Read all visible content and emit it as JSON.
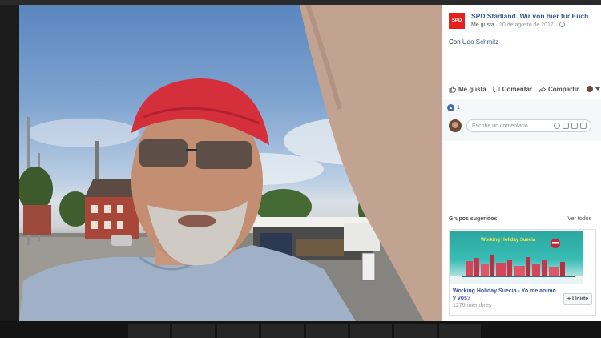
{
  "post": {
    "page_name": "SPD Stadland. Wir von hier für Euch",
    "page_logo": "SPD",
    "like_link": "Me gusta",
    "date": " · 10 de agosto de 2017 ·",
    "caption_prefix": "Con ",
    "tagged_person": "Udo Schmitz",
    "like_count": "1"
  },
  "actions": {
    "like_label": "Me gusta",
    "comment_label": "Comentar",
    "share_label": "Compartir"
  },
  "comment": {
    "placeholder": "Escribe un comentario..."
  },
  "groups": {
    "title": "Grupos sugeridos",
    "see_all": "Ver todos",
    "card": {
      "banner_title": "Working Holiday Suecia",
      "name": "Working Holiday Suecia - Yo me animo y vos?",
      "members": "1276 miembres",
      "join_label": "+ Unirte"
    }
  },
  "colors": {
    "link": "#385898",
    "brand_red": "#e4221b",
    "facebook_blue": "#4267b2"
  }
}
